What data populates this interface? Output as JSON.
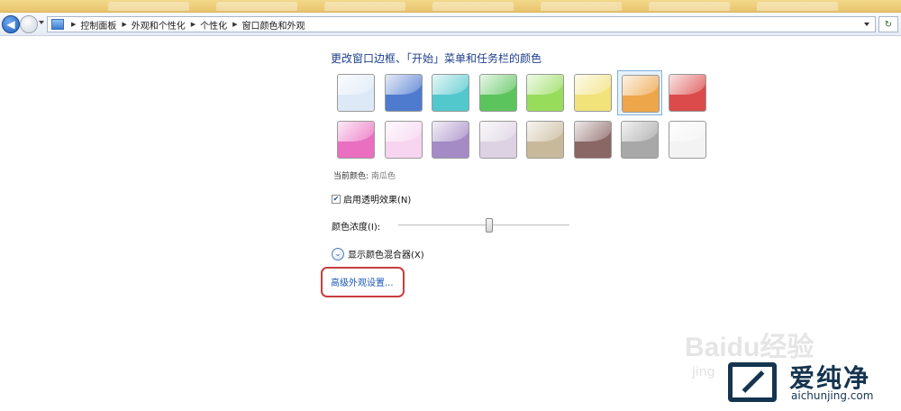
{
  "address_bar": {
    "breadcrumbs": [
      "控制面板",
      "外观和个性化",
      "个性化",
      "窗口颜色和外观"
    ],
    "icon": "control-panel-icon"
  },
  "main": {
    "heading": "更改窗口边框、「开始」菜单和任务栏的颜色",
    "swatches": [
      {
        "name": "sky",
        "color": "#dde9f6",
        "selected": false
      },
      {
        "name": "twilight",
        "color": "#4f7bcf",
        "selected": false
      },
      {
        "name": "sea",
        "color": "#52c8cc",
        "selected": false
      },
      {
        "name": "leaf",
        "color": "#5cc45c",
        "selected": false
      },
      {
        "name": "lime",
        "color": "#98dc5c",
        "selected": false
      },
      {
        "name": "sun",
        "color": "#f2e27a",
        "selected": false
      },
      {
        "name": "pumpkin",
        "color": "#eda64a",
        "selected": true
      },
      {
        "name": "ruby",
        "color": "#db4b4b",
        "selected": false
      },
      {
        "name": "fuchsia",
        "color": "#ea6fc0",
        "selected": false
      },
      {
        "name": "blush",
        "color": "#f7d4ef",
        "selected": false
      },
      {
        "name": "violet",
        "color": "#a48bc6",
        "selected": false
      },
      {
        "name": "lavender",
        "color": "#dcd2e3",
        "selected": false
      },
      {
        "name": "taupe",
        "color": "#c9b99b",
        "selected": false
      },
      {
        "name": "chocolate",
        "color": "#8a6665",
        "selected": false
      },
      {
        "name": "slate",
        "color": "#a8a8a8",
        "selected": false
      },
      {
        "name": "frost",
        "color": "#f3f3f3",
        "selected": false
      }
    ],
    "current_color_label": "当前颜色:",
    "current_color_value": "南瓜色",
    "transparency_label": "启用透明效果(N)",
    "transparency_checked": true,
    "intensity_label": "颜色浓度(I):",
    "intensity_value": 0.53,
    "mixer_label": "显示颜色混合器(X)",
    "advanced_link": "高级外观设置..."
  },
  "watermark": {
    "baidu": "Baidu经验",
    "baidu_sub": "jing",
    "brand": "爱纯净",
    "site": "aichunjing.com"
  }
}
